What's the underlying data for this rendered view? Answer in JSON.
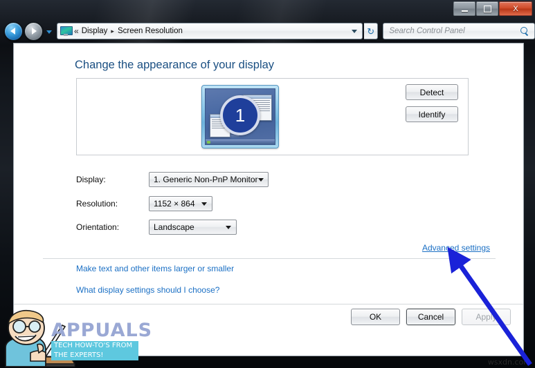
{
  "window": {
    "caption": {
      "minimize_label": "Minimize",
      "maximize_label": "Maximize",
      "close_label": "X"
    }
  },
  "navbar": {
    "back_label": "Back",
    "forward_label": "Forward",
    "address": {
      "overflow_chevron": "«",
      "crumb1": "Display",
      "separator": "▸",
      "crumb2": "Screen Resolution",
      "refresh_glyph": "↻"
    },
    "search": {
      "placeholder": "Search Control Panel",
      "value": ""
    }
  },
  "page": {
    "title": "Change the appearance of your display",
    "preview": {
      "monitor_number": "1"
    },
    "side_buttons": {
      "detect": "Detect",
      "identify": "Identify"
    },
    "form": {
      "display_label": "Display:",
      "display_value": "1. Generic Non-PnP Monitor",
      "resolution_label": "Resolution:",
      "resolution_value": "1152 × 864",
      "orientation_label": "Orientation:",
      "orientation_value": "Landscape"
    },
    "links": {
      "advanced_settings": "Advanced settings",
      "make_text_larger": "Make text and other items larger or smaller",
      "what_settings": "What display settings should I choose?"
    },
    "footer": {
      "ok": "OK",
      "cancel": "Cancel",
      "apply": "Apply"
    }
  },
  "watermark": {
    "brand": "APPUALS",
    "tagline_line1": "TECH HOW-TO'S FROM",
    "tagline_line2": "THE EXPERTS!",
    "corner": "wsxdn.com"
  },
  "colors": {
    "link": "#1a6fc4",
    "heading": "#1a4f82",
    "arrow": "#1a22d8",
    "accent_brand": "#9aa8d4",
    "tag_bg": "#5ec8df"
  }
}
